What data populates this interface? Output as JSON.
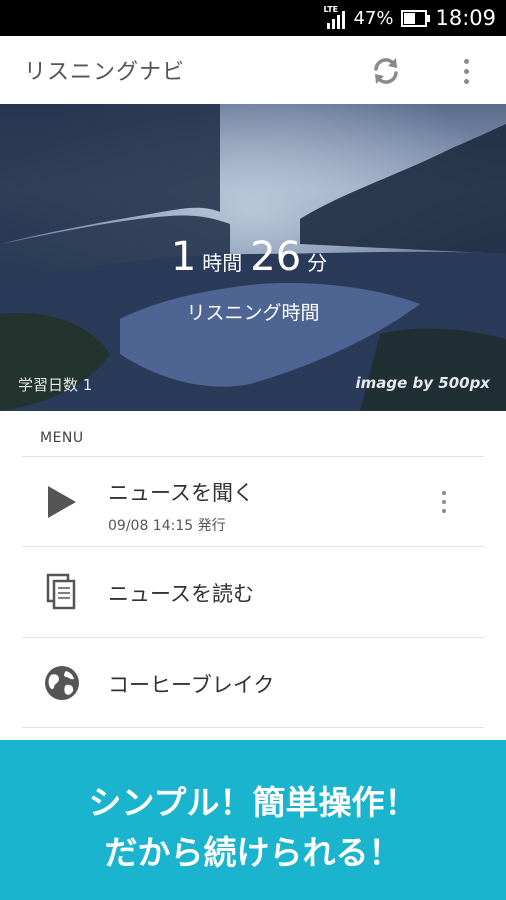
{
  "status_bar": {
    "network": "LTE",
    "battery_percent": "47%",
    "battery_level": 0.47,
    "time": "18:09"
  },
  "app_bar": {
    "title": "リスニングナビ",
    "refresh_icon": "refresh-icon",
    "overflow_icon": "overflow-menu-icon"
  },
  "hero": {
    "hours": "1",
    "hours_unit": "時間",
    "minutes": "26",
    "minutes_unit": "分",
    "subtitle": "リスニング時間",
    "study_days": "学習日数 1",
    "credit": "image by 500px"
  },
  "menu": {
    "header": "MENU",
    "items": [
      {
        "icon": "play-icon",
        "title": "ニュースを聞く",
        "subtitle": "09/08 14:15 発行",
        "has_more": true
      },
      {
        "icon": "documents-icon",
        "title": "ニュースを読む"
      },
      {
        "icon": "globe-icon",
        "title": "コーヒーブレイク"
      }
    ]
  },
  "banner": {
    "line1": "シンプル！簡単操作！",
    "line2": "だから続けられる！",
    "color": "#1ab4cf"
  }
}
